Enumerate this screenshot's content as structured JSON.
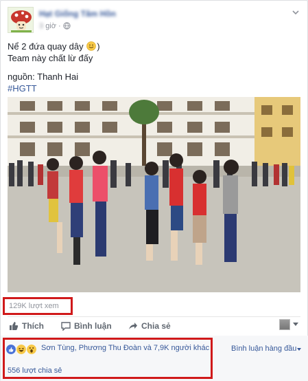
{
  "header": {
    "page_name": "Hạt Giống Tâm Hồn",
    "time_prefix": "3",
    "time_label": "giờ",
    "separator": "·",
    "avatar_icon": "mushroom-character-icon",
    "privacy_icon": "globe-icon",
    "menu_icon": "chevron-down-icon"
  },
  "post": {
    "line1": "Nể 2 đứa quay dây ",
    "line1_end": ")",
    "emoji": "smile-emoji",
    "line2": "Team này chất lừ đấy",
    "source": "nguồn: Thanh Hai",
    "hashtag": "#HGTT"
  },
  "video": {
    "description": ""
  },
  "stats": {
    "views": "129K lượt xem"
  },
  "actions": {
    "like_label": "Thích",
    "comment_label": "Bình luận",
    "share_label": "Chia sẻ"
  },
  "reactions": {
    "icons": [
      "like-icon",
      "haha-icon",
      "wow-icon"
    ],
    "summary": "Sơn Tùng, Phương Thu Đoàn và 7,9K người khác",
    "shares": "556 lượt chia sẻ",
    "sort_label": "Bình luận hàng đầu"
  },
  "colors": {
    "link": "#365899",
    "highlight_border": "#d0191a",
    "muted": "#90949c"
  }
}
